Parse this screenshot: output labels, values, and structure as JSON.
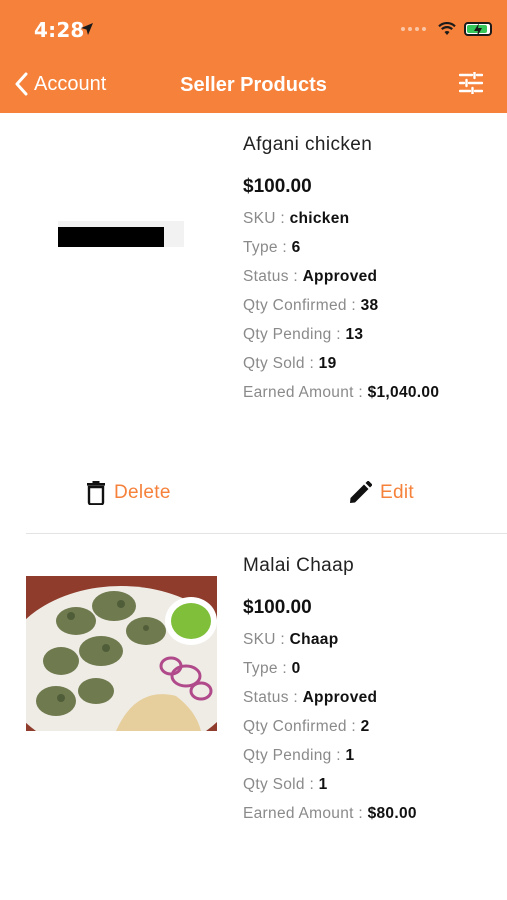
{
  "status_bar": {
    "time": "4:28"
  },
  "nav": {
    "back_label": "Account",
    "title": "Seller Products"
  },
  "colors": {
    "accent": "#F5813A",
    "battery": "#35C759"
  },
  "labels": {
    "sku": "SKU : ",
    "type": "Type : ",
    "status": "Status : ",
    "qty_confirmed": "Qty Confirmed : ",
    "qty_pending": "Qty Pending : ",
    "qty_sold": "Qty Sold : ",
    "earned_amount": "Earned Amount : "
  },
  "products": [
    {
      "name": "Afgani chicken",
      "price": "$100.00",
      "sku": "chicken",
      "type": "6",
      "status": "Approved",
      "qty_confirmed": "38",
      "qty_pending": "13",
      "qty_sold": "19",
      "earned_amount": "$1,040.00",
      "actions": {
        "delete": "Delete",
        "edit": "Edit"
      }
    },
    {
      "name": "Malai Chaap",
      "price": "$100.00",
      "sku": "Chaap",
      "type": "0",
      "status": "Approved",
      "qty_confirmed": "2",
      "qty_pending": "1",
      "qty_sold": "1",
      "earned_amount": "$80.00"
    }
  ]
}
